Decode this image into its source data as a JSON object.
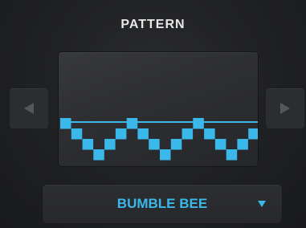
{
  "panel": {
    "title": "PATTERN"
  },
  "navigation": {
    "prev_icon": "triangle-left-icon",
    "next_icon": "triangle-right-icon"
  },
  "pattern_display": {
    "accent_color": "#3bb8ea",
    "pattern_levels": [
      3,
      2,
      1,
      0,
      1,
      2,
      3,
      2,
      1,
      0,
      1,
      2,
      3,
      2,
      1,
      0,
      1,
      2
    ]
  },
  "pattern_select": {
    "selected": "BUMBLE BEE",
    "caret_icon": "caret-down-icon"
  }
}
